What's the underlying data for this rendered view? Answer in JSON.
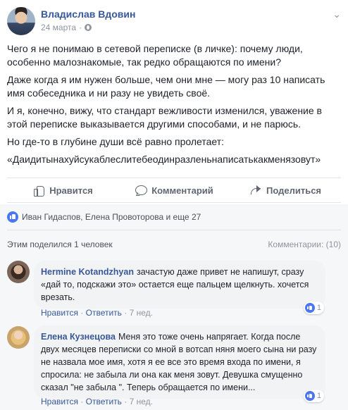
{
  "author": {
    "name": "Владислав Вдовин",
    "date": "24 марта"
  },
  "post": {
    "paragraphs": [
      "Чего я не понимаю в сетевой переписке (в личке): почему люди, особенно малознакомые, так редко обращаются по имени?",
      "Даже когда я им нужен больше, чем они мне — могу раз 10 написать имя собеседника и ни разу не увидеть своё.",
      "И я, конечно, вижу, что стандарт вежливости изменился, уважение в этой переписке выказывается другими способами, и не парюсь.",
      "Но где-то в глубине души всё равно пролетает:",
      "«Даидитынахуйсукаблеслитебеодинразленьнаписатькакменязовут»"
    ]
  },
  "actions": {
    "like": "Нравится",
    "comment": "Комментарий",
    "share": "Поделиться"
  },
  "likes_summary": "Иван Гидаспов, Елена Провоторова и еще 27",
  "shared_text": "Этим поделился 1 человек",
  "comments_count": "Комментарии: (10)",
  "comments": [
    {
      "name": "Hermine Kotandzhyan",
      "text": "зачастую даже привет не напишут, сразу «дай то, подскажи это» остается еще пальцем щелкнуть. хочется врезать.",
      "like_label": "Нравится",
      "reply_label": "Ответить",
      "time": "7 нед.",
      "reactions": "1"
    },
    {
      "name": "Елена Кузнецова",
      "text": "Меня это тоже очень напрягает. Когда после двух месяцев переписки со мной в вотсап няня моего сына ни разу не назвала мое имя, хотя я ее все это время входа по имени, я спросила: не забыла ли она как меня зовут. Девушка смущенно сказал \"не забыла \". Теперь обращается по имени...",
      "like_label": "Нравится",
      "reply_label": "Ответить",
      "time": "7 нед.",
      "reactions": "1"
    }
  ],
  "separator": "·",
  "icons": [
    "globe-icon",
    "chevron-down-icon",
    "like-icon",
    "comment-icon",
    "share-icon",
    "like-badge-icon"
  ]
}
